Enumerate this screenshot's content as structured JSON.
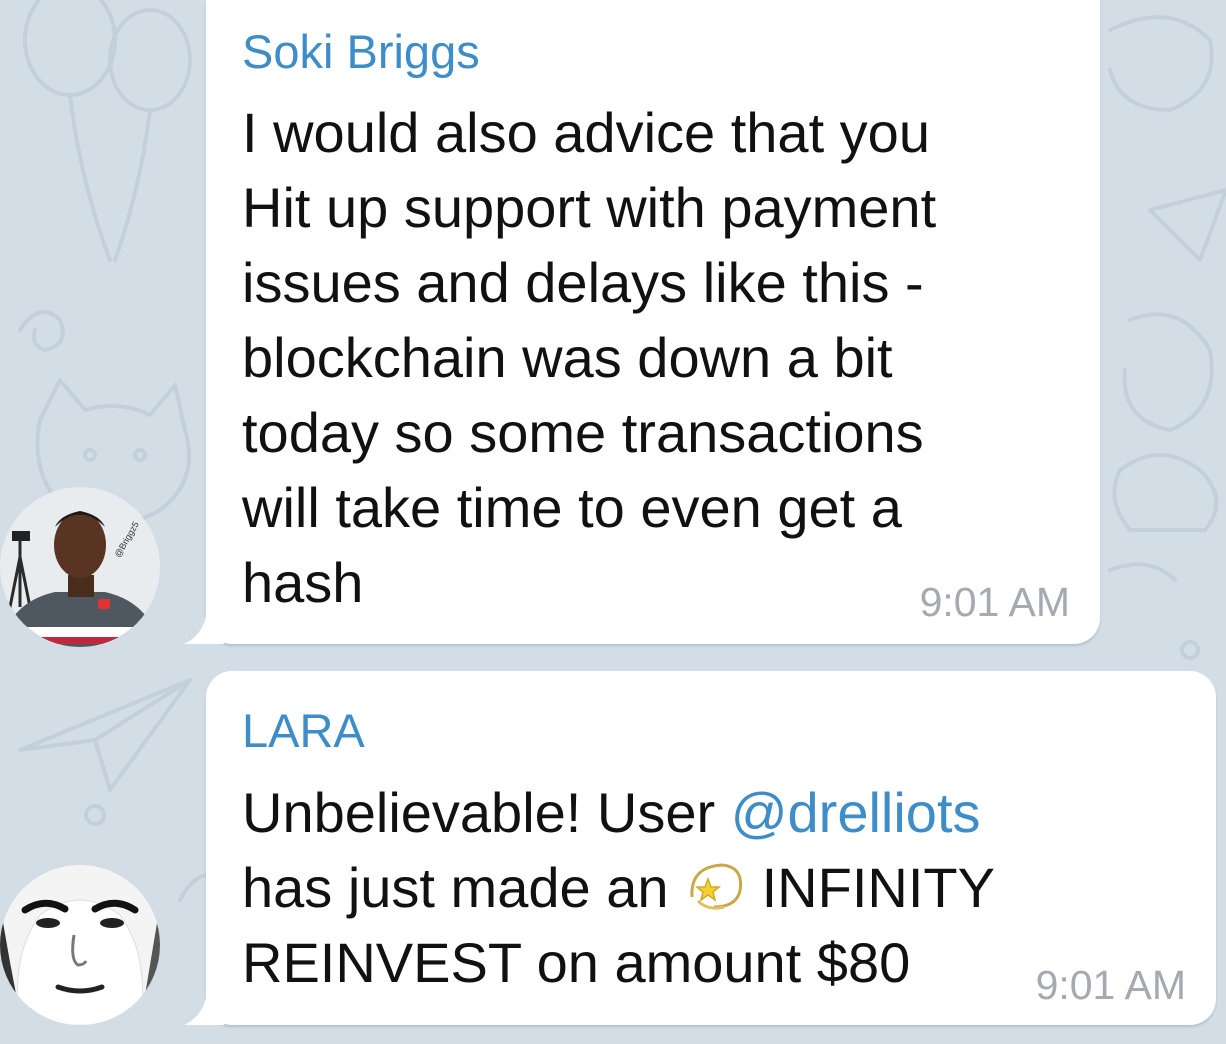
{
  "chat": {
    "messages": [
      {
        "sender": "Soki Briggs",
        "text": "I would also advice that you\nHit up support with payment\nissues and delays like this -\nblockchain was down a bit\ntoday so some transactions\nwill take time to even get a\nhash",
        "time": "9:01 AM",
        "avatar_watermark": "@Briggz5"
      },
      {
        "sender": "LARA",
        "text_line1_prefix": "Unbelievable! User ",
        "mention": "@drelliots",
        "text_line2_prefix": "has just made an ",
        "emoji": "dizzy-star",
        "text_line2_suffix": " INFINITY",
        "text_line3": "REINVEST on amount $80",
        "time": "9:01 AM"
      }
    ]
  },
  "colors": {
    "wallpaper": "#d3dde6",
    "bubble": "#ffffff",
    "sender_name": "#3e8dc8",
    "mention": "#3e8dc8",
    "timestamp": "#a4aab0",
    "text": "#111111"
  }
}
